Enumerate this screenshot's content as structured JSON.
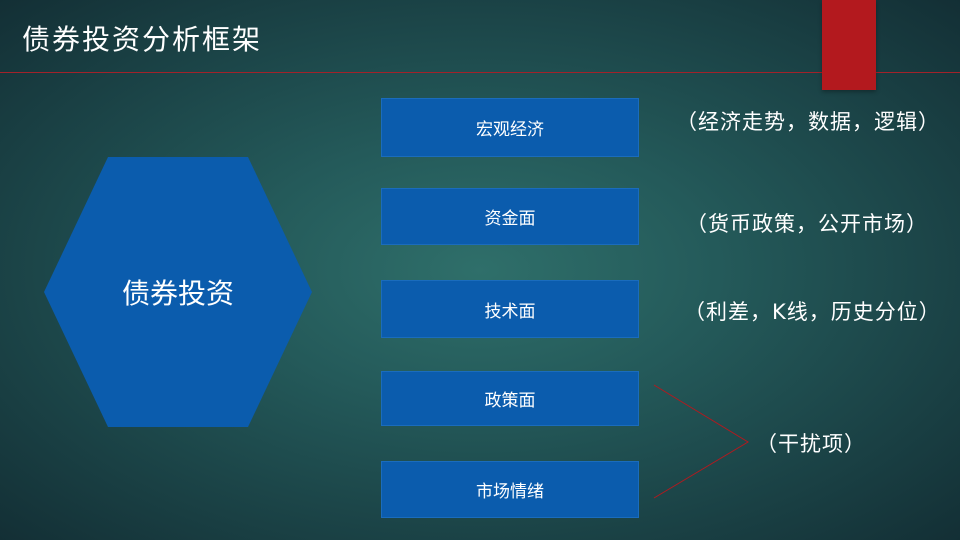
{
  "slide": {
    "title": "债券投资分析框架"
  },
  "hexagon": {
    "label": "债券投资"
  },
  "boxes": [
    {
      "label": "宏观经济"
    },
    {
      "label": "资金面"
    },
    {
      "label": "技术面"
    },
    {
      "label": "政策面"
    },
    {
      "label": "市场情绪"
    }
  ],
  "notes": [
    {
      "text": "（经济走势，数据，逻辑）"
    },
    {
      "text": "（货币政策，公开市场）"
    },
    {
      "text": "（利差，K线，历史分位）"
    },
    {
      "text": "（干扰项）"
    }
  ],
  "colors": {
    "accent_red": "#b3191e",
    "box_blue": "#0b5cad",
    "background": "#245a5a"
  }
}
